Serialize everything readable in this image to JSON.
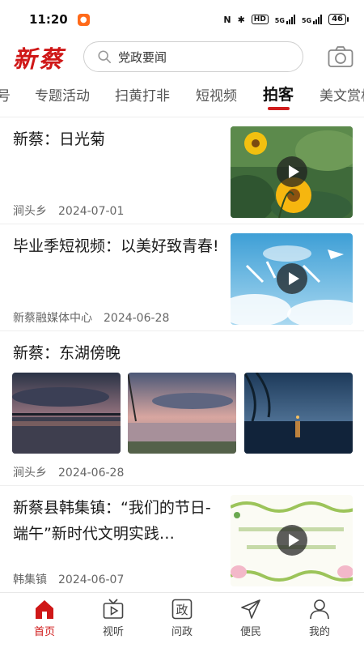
{
  "status_bar": {
    "time": "11:20",
    "network": "HD",
    "signal_1": "5G",
    "signal_2": "5G",
    "battery": "46"
  },
  "header": {
    "logo": "新蔡",
    "search_placeholder": "党政要闻"
  },
  "tabs": [
    {
      "label": "号"
    },
    {
      "label": "专题活动"
    },
    {
      "label": "扫黄打非"
    },
    {
      "label": "短视频"
    },
    {
      "label": "拍客",
      "active": true
    },
    {
      "label": "美文赏析"
    }
  ],
  "articles": [
    {
      "title": "新蔡：日光菊",
      "source": "涧头乡",
      "date": "2024-07-01",
      "has_video": true
    },
    {
      "title": "毕业季短视频：以美好致青春!",
      "source": "新蔡融媒体中心",
      "date": "2024-06-28",
      "has_video": true
    },
    {
      "title": "新蔡：东湖傍晚",
      "source": "涧头乡",
      "date": "2024-06-28",
      "has_video": false
    },
    {
      "title": "新蔡县韩集镇：“我们的节日-端午”新时代文明实践…",
      "source": "韩集镇",
      "date": "2024-06-07",
      "has_video": true
    }
  ],
  "bottom_nav": [
    {
      "label": "首页",
      "icon": "home-icon",
      "active": true
    },
    {
      "label": "视听",
      "icon": "tv-icon"
    },
    {
      "label": "问政",
      "icon": "zheng-icon",
      "glyph": "政"
    },
    {
      "label": "便民",
      "icon": "send-icon"
    },
    {
      "label": "我的",
      "icon": "user-icon"
    }
  ],
  "colors": {
    "brand_red": "#cf1717",
    "accent_underline": "#d01d1d"
  }
}
